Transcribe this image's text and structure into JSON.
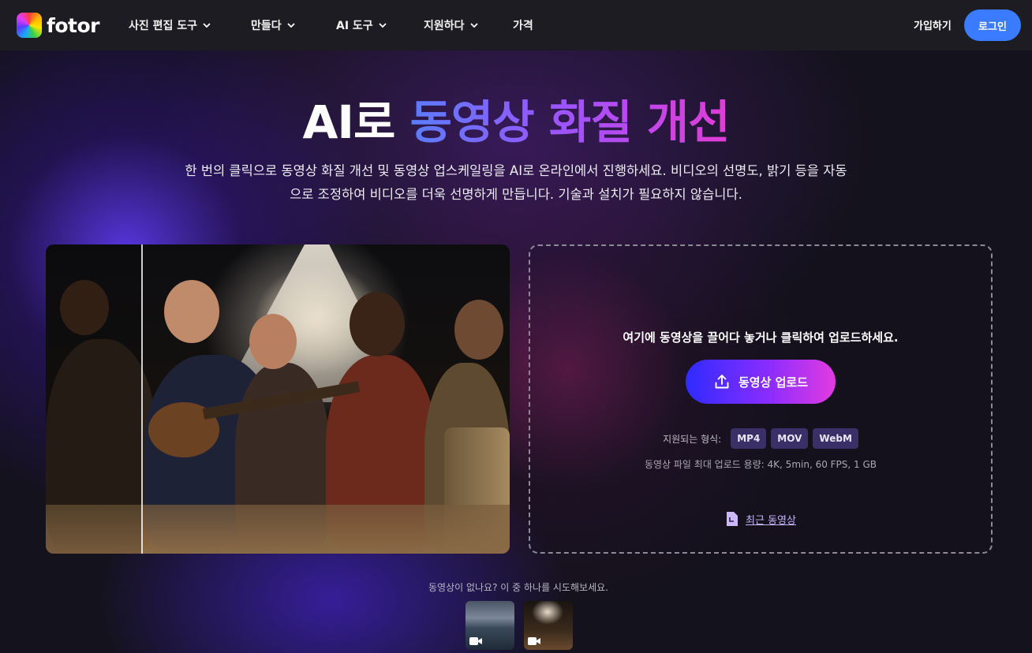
{
  "brand": {
    "name": "fotor"
  },
  "nav": {
    "items": [
      {
        "label": "사진 편집 도구",
        "has_dropdown": true
      },
      {
        "label": "만들다",
        "has_dropdown": true
      },
      {
        "label": "AI 도구",
        "has_dropdown": true
      },
      {
        "label": "지원하다",
        "has_dropdown": true
      },
      {
        "label": "가격",
        "has_dropdown": false
      }
    ],
    "signup_label": "가입하기",
    "login_label": "로그인"
  },
  "hero": {
    "title_plain": "AI로 ",
    "title_highlight": "동영상 화질 개선",
    "subtitle_line1": "한 번의 클릭으로 동영상 화질 개선 및 동영상 업스케일링을 AI로 온라인에서 진행하세요. 비디오의 선명도, 밝기 등을 자동",
    "subtitle_line2": "으로 조정하여 비디오를 더욱 선명하게 만듭니다. 기술과 설치가 필요하지 않습니다."
  },
  "upload": {
    "drop_text": "여기에 동영상을 끌어다 놓거나 클릭하여 업로드하세요.",
    "button_label": "동영상 업로드",
    "formats_label": "지원되는 형식:",
    "formats": [
      "MP4",
      "MOV",
      "WebM"
    ],
    "limits": "동영상 파일 최대 업로드 용량: 4K, 5min, 60 FPS, 1 GB",
    "recent_label": "최근 동영상"
  },
  "samples": {
    "label": "동영상이 없나요? 이 중 하나를 시도해보세요."
  },
  "colors": {
    "accent_blue": "#3b7bff",
    "title_gradient_start": "#5a7dff",
    "title_gradient_end": "#e23bd6",
    "chip_bg": "#3a2f66"
  }
}
